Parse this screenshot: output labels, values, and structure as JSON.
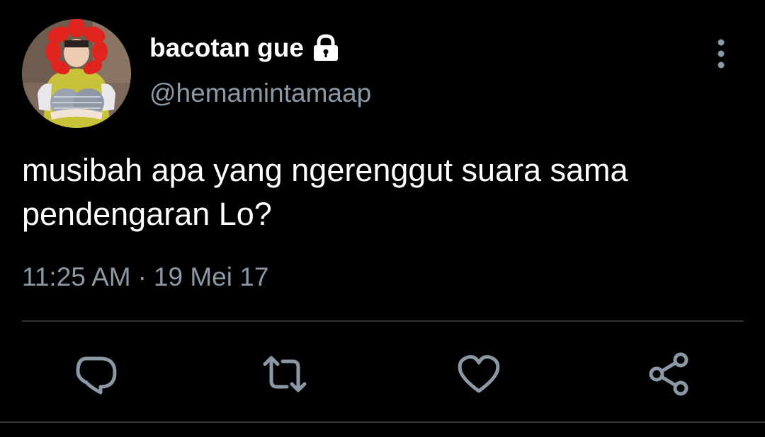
{
  "tweet": {
    "display_name": "bacotan gue",
    "handle": "@hemamintamaap",
    "text_line1": "musibah apa yang ngerenggut suara sama",
    "text_line2": "pendengaran Lo?",
    "time": "11:25 AM",
    "separator": "·",
    "date": "19 Mei 17",
    "protected_account": true
  },
  "icons": {
    "lock": "lock-icon",
    "more": "more-vertical-icon",
    "reply": "reply-icon",
    "retweet": "retweet-icon",
    "like": "heart-icon",
    "share": "share-icon"
  },
  "colors": {
    "background": "#000000",
    "text_primary": "#ffffff",
    "text_secondary": "#8b98a5",
    "divider": "#2f3336"
  }
}
